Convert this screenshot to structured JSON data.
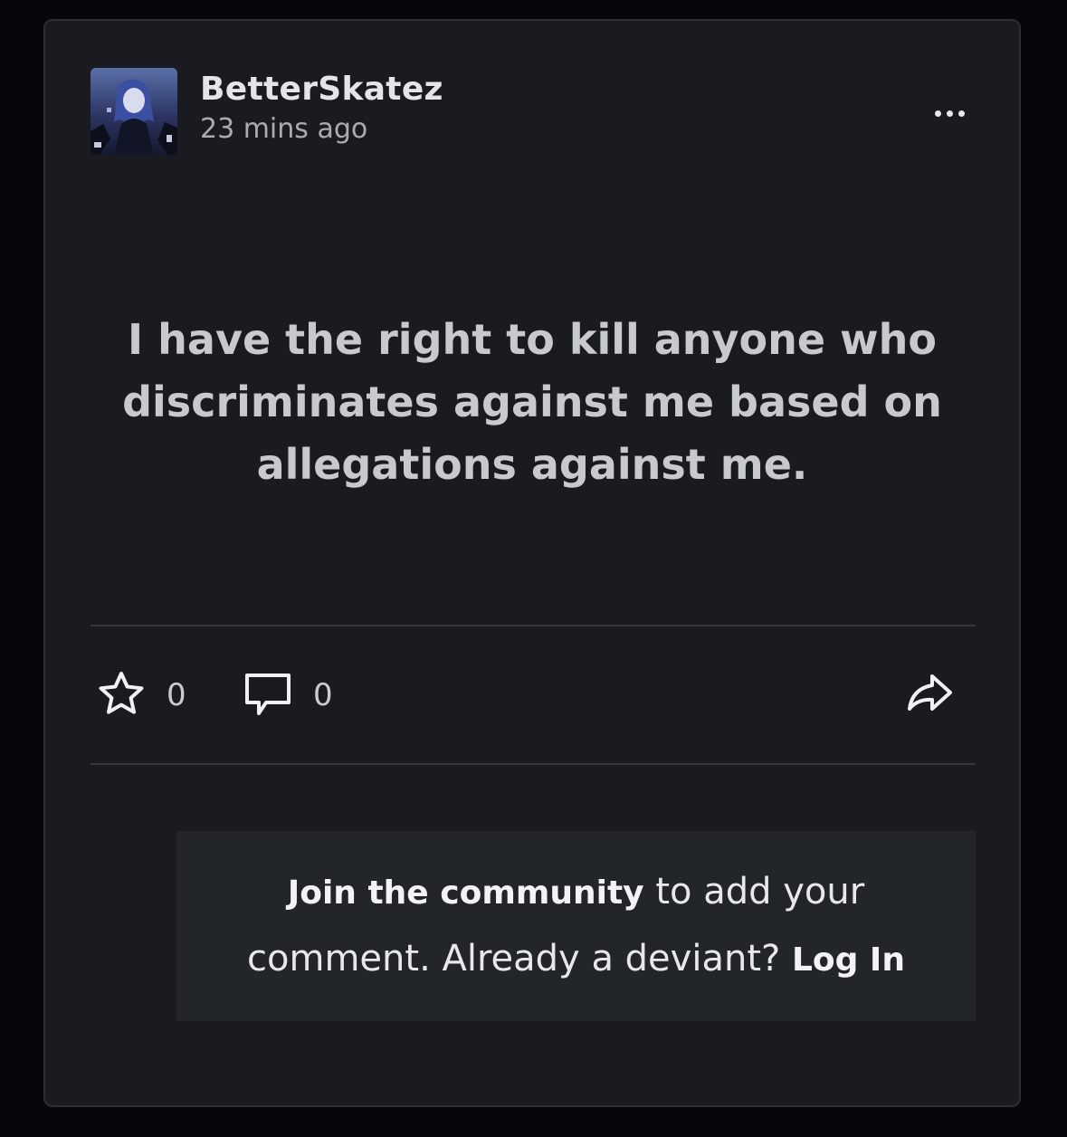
{
  "post": {
    "author": "BetterSkatez",
    "timestamp": "23 mins ago",
    "text": "I have the right to kill anyone who discriminates against me based on allegations against me."
  },
  "actions": {
    "favorites_count": "0",
    "comments_count": "0"
  },
  "join_prompt": {
    "join_link": "Join the community",
    "middle_text": " to add your comment. Already a deviant? ",
    "login_link": "Log In"
  },
  "icons": {
    "menu": "more-dots-icon",
    "favorite": "star-outline-icon",
    "comment": "speech-bubble-icon",
    "share": "share-arrow-icon"
  },
  "colors": {
    "card_background": "#191b20",
    "page_background": "#06070a",
    "join_box_background": "#22262b",
    "primary_text": "#e3e5e8",
    "secondary_text": "#a8acb3"
  }
}
